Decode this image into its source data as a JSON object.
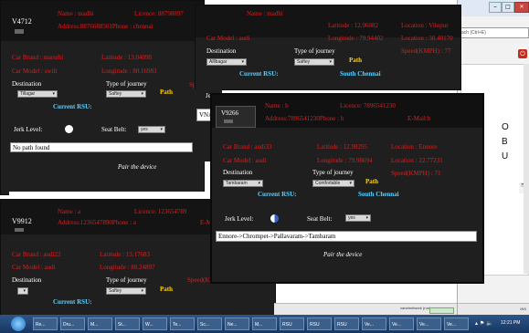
{
  "window1": {
    "vehicle_id": "V4712",
    "name_label": "Name : madhi",
    "licence": "Licence: 88798897",
    "address_phone": "Address:8876688561Phone : chennai",
    "car_brand": "Car Brand : maruthi",
    "car_model": "Car Model : swift",
    "latitude": "Latitude : 13.04098",
    "longitude": "Longitude : 80.16983",
    "spee": "Spee",
    "destination_label": "Destination",
    "destination_value": "Tillagar",
    "journey_label": "Type of journey",
    "journey_value": "Saftey",
    "path_label": "Path",
    "current_rsu_label": "Current RSU:",
    "jerk_label": "Jerk Level:",
    "seat_label": "Seat Belt:",
    "seat_value": "yes",
    "path_result": "No path found",
    "pair_button": "Pair the device"
  },
  "window2": {
    "name_label": "Name : madhi",
    "latitude_top": "Latitude : 12.96082",
    "location_top": "Location : Vilupur",
    "car_model": "Car Model : audi",
    "longitude": "Longitude : 79.94402",
    "location2": "Location : 30.40170",
    "destination_label": "Destination",
    "destination_value": "Alllbagar",
    "journey_label": "Type of journey",
    "journey_value": "Saftey",
    "path_label": "Path",
    "speed": "Speed(KMPH) : 77",
    "current_rsu_label": "Current RSU:",
    "current_rsu_value": "South Chennai",
    "partial_left": "VNA",
    "partial_left2": "Je"
  },
  "window3": {
    "vehicle_id": "V9912",
    "name_label": "Name : a",
    "licence": "Licence: 123654789",
    "address_phone": "Address:1236547890Phone : a",
    "email_partial": "E-M",
    "car_brand": "Car Brand : audi22",
    "car_model": "Car Model : audi",
    "latitude": "Latitude : 13.17683",
    "longitude": "Longitude : 80.24897",
    "speed_partial": "Speed(KM",
    "destination_label": "Destination",
    "destination_value": "",
    "journey_label": "Type of journey",
    "journey_value": "Saftey",
    "path_label": "Path",
    "current_rsu_label": "Current RSU:"
  },
  "window4": {
    "vehicle_id": "V9266",
    "name_label": "Name : b",
    "licence": "Licence: 7896541230",
    "address_phone": "Address:7896541230Phone : b",
    "email": "E-Mail:b",
    "car_brand": "Car Brand : audi33",
    "car_model": "Car Model : audi",
    "latitude": "Latitude : 12.98295",
    "longitude": "Longitude : 79.98694",
    "location": "Location : Ennore",
    "location2": "Location : 22.77231",
    "speed": "Speed(KMPH) : 71",
    "destination_label": "Destination",
    "destination_value": "Tambaram",
    "journey_label": "Type of journey",
    "journey_value": "Comfortable",
    "path_label": "Path",
    "current_rsu_label": "Current RSU:",
    "current_rsu_value": "South Chennai",
    "jerk_label": "Jerk Level:",
    "seat_label": "Seat Belt:",
    "seat_value": "yes",
    "path_result": "Ennore->Chrompet->Pallavaram->Tambaram",
    "pair_button": "Pair the device"
  },
  "browser": {
    "address_text": "ach (Ctrl+E)",
    "right_letters": [
      "O",
      "B",
      "U"
    ],
    "status_text": "vanetnetwork (run)",
    "zoom_text": "INS"
  },
  "taskbar": {
    "buttons": [
      "Re...",
      "Dru...",
      "M...",
      "St...",
      "W...",
      "Te...",
      "Sc...",
      "Ne...",
      "M...",
      "RSU",
      "RSU",
      "RSU",
      "Ve...",
      "Ve...",
      "Ve...",
      "Ve..."
    ],
    "clock": "12:21 PM"
  },
  "colors": {
    "accent_red": "#e11d1d",
    "path_yellow": "#ffd400",
    "rsu_cyan": "#5fd0ff",
    "panel_bg": "#1f1f1f",
    "taskbar_bg": "#1c3d66"
  }
}
